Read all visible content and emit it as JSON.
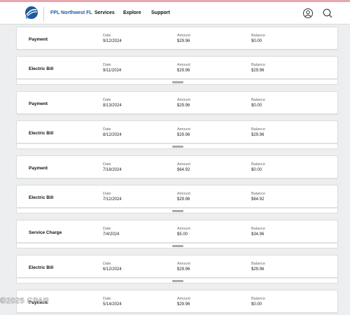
{
  "header": {
    "logo_text": "FPL",
    "brand": "FPL Northwest FL",
    "nav": [
      "Services",
      "Explore",
      "Support"
    ],
    "icons": [
      "user-icon",
      "search-icon"
    ],
    "accent": "#1f5aa0"
  },
  "labels": {
    "date": "Date",
    "amount": "Amount",
    "balance": "Balance"
  },
  "transactions": [
    {
      "title": "Payment",
      "date": "9/12/2024",
      "amount": "$29.96",
      "balance": "$0.00",
      "drawer": false
    },
    {
      "title": "Electric Bill",
      "date": "9/11/2024",
      "amount": "$29.96",
      "balance": "$29.96",
      "drawer": true
    },
    {
      "title": "Payment",
      "date": "8/13/2024",
      "amount": "$29.96",
      "balance": "$0.00",
      "drawer": false
    },
    {
      "title": "Electric Bill",
      "date": "8/12/2024",
      "amount": "$29.96",
      "balance": "$29.96",
      "drawer": true
    },
    {
      "title": "Payment",
      "date": "7/18/2024",
      "amount": "$64.92",
      "balance": "$0.00",
      "drawer": false
    },
    {
      "title": "Electric Bill",
      "date": "7/12/2024",
      "amount": "$29.96",
      "balance": "$64.92",
      "drawer": true
    },
    {
      "title": "Service Charge",
      "date": "7/4/2024",
      "amount": "$5.00",
      "balance": "$34.96",
      "drawer": true
    },
    {
      "title": "Electric Bill",
      "date": "6/12/2024",
      "amount": "$29.96",
      "balance": "$29.96",
      "drawer": true
    },
    {
      "title": "Payment",
      "date": "5/14/2024",
      "amount": "$29.96",
      "balance": "$0.00",
      "drawer": false
    }
  ],
  "watermark": "©2025 CPAR"
}
